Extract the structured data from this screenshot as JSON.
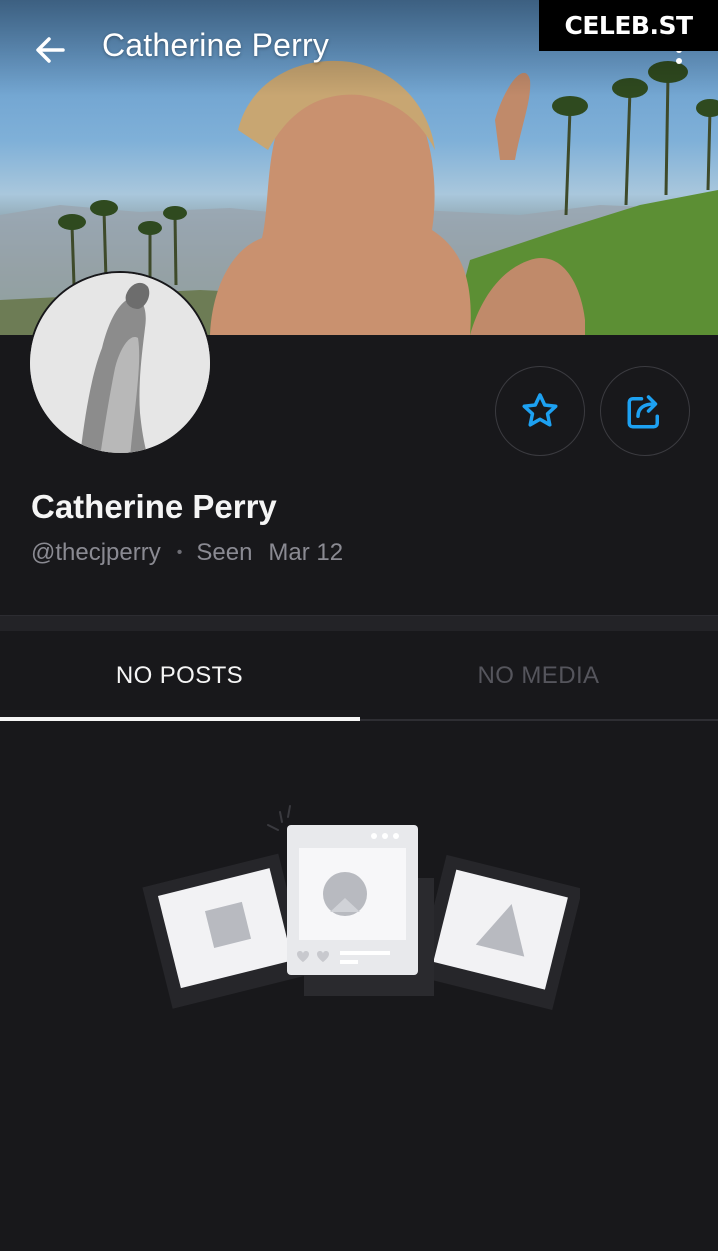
{
  "header": {
    "title": "Catherine Perry",
    "back_icon": "arrow-left-icon",
    "more_icon": "more-vertical-icon"
  },
  "watermark": {
    "text": "CELEB.ST"
  },
  "profile": {
    "name": "Catherine Perry",
    "username": "@thecjperry",
    "separator": "•",
    "seen_label": "Seen",
    "seen_date": "Mar 12"
  },
  "actions": {
    "favorite_icon": "star-outline-icon",
    "share_icon": "share-icon",
    "accent_color": "#1da1f2"
  },
  "tabs": [
    {
      "label": "NO POSTS",
      "active": true
    },
    {
      "label": "NO MEDIA",
      "active": false
    }
  ],
  "colors": {
    "background": "#18181b",
    "muted_text": "#8a8a92",
    "inactive_tab": "#55555c"
  }
}
